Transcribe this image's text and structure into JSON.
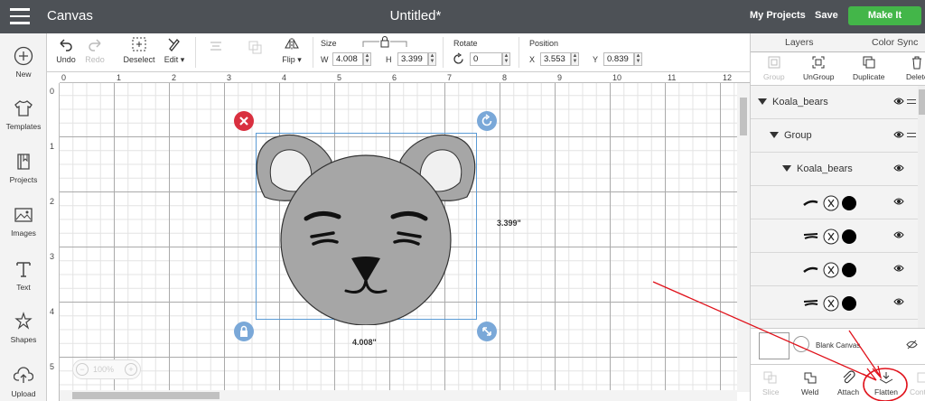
{
  "app": {
    "title": "Canvas",
    "document_title": "Untitled*",
    "my_projects": "My Projects",
    "save": "Save",
    "make_it": "Make It"
  },
  "toolbar": {
    "undo": "Undo",
    "redo": "Redo",
    "deselect": "Deselect",
    "edit": "Edit",
    "flip": "Flip",
    "size_label": "Size",
    "w_label": "W",
    "w_value": "4.008",
    "h_label": "H",
    "h_value": "3.399",
    "rotate_label": "Rotate",
    "rotate_value": "0",
    "position_label": "Position",
    "x_label": "X",
    "x_value": "3.553",
    "y_label": "Y",
    "y_value": "0.839"
  },
  "sidebar": {
    "items": [
      {
        "label": "New",
        "icon": "plus-circle-icon"
      },
      {
        "label": "Templates",
        "icon": "shirt-icon"
      },
      {
        "label": "Projects",
        "icon": "book-icon"
      },
      {
        "label": "Images",
        "icon": "image-icon"
      },
      {
        "label": "Text",
        "icon": "text-icon"
      },
      {
        "label": "Shapes",
        "icon": "shapes-icon"
      },
      {
        "label": "Upload",
        "icon": "upload-icon"
      }
    ]
  },
  "canvas": {
    "ruler_x": [
      "0",
      "1",
      "2",
      "3",
      "4",
      "5",
      "6",
      "7",
      "8",
      "9",
      "10",
      "11",
      "12"
    ],
    "ruler_y": [
      "0",
      "1",
      "2",
      "3",
      "4",
      "5"
    ],
    "width_dim": "4.008\"",
    "height_dim": "3.399\"",
    "zoom": "100%",
    "zoom_minus": "−",
    "zoom_plus": "+"
  },
  "panel": {
    "tabs": [
      "Layers",
      "Color Sync"
    ],
    "tools": [
      "Group",
      "UnGroup",
      "Duplicate",
      "Delete"
    ],
    "layers": [
      {
        "label": "Koala_bears",
        "level": 0
      },
      {
        "label": "Group",
        "level": 1
      },
      {
        "label": "Koala_bears",
        "level": 2
      }
    ],
    "blank_canvas": "Blank Canvas",
    "bottom_tools": [
      "Slice",
      "Weld",
      "Attach",
      "Flatten",
      "Contour"
    ]
  },
  "colors": {
    "topbar": "#4d5156",
    "accent_green": "#43b649",
    "koala_gray": "#a6a6a6",
    "selection": "#5b9bd5",
    "annotation_red": "#e0121b"
  }
}
